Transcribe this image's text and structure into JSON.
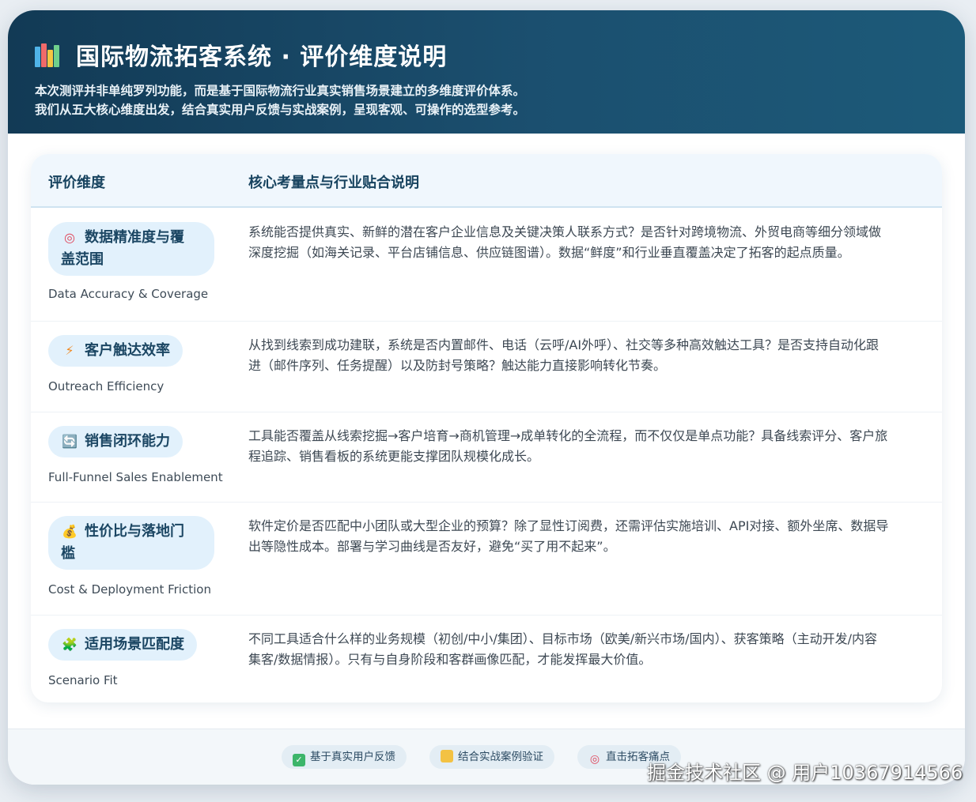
{
  "header": {
    "icon": "bar-chart-icon",
    "title": "国际物流拓客系统 · 评价维度说明",
    "subtitle_line1": "本次测评并非单纯罗列功能，而是基于国际物流行业真实销售场景建立的多维度评价体系。",
    "subtitle_line2": "我们从五大核心维度出发，结合真实用户反馈与实战案例，呈现客观、可操作的选型参考。"
  },
  "table": {
    "col1": "评价维度",
    "col2": "核心考量点与行业贴合说明",
    "rows": [
      {
        "icon": "target-icon",
        "name": "数据精准度与覆盖范围",
        "name_line1": "数据精准度与覆",
        "name_line2": "盖范围",
        "en": "Data Accuracy & Coverage",
        "desc_line1": "系统能否提供真实、新鲜的潜在客户企业信息及关键决策人联系方式？是否针对跨境物流、外贸电商等细分领域做",
        "desc_line2": "深度挖掘（如海关记录、平台店铺信息、供应链图谱）。数据“鲜度”和行业垂直覆盖决定了拓客的起点质量。"
      },
      {
        "icon": "lightning-icon",
        "name": "客户触达效率",
        "en": "Outreach Efficiency",
        "desc_line1": "从找到线索到成功建联，系统是否内置邮件、电话（云呼/AI外呼）、社交等多种高效触达工具？是否支持自动化跟",
        "desc_line2": "进（邮件序列、任务提醒）以及防封号策略？触达能力直接影响转化节奏。"
      },
      {
        "icon": "cycle-icon",
        "name": "销售闭环能力",
        "en": "Full-Funnel Sales Enablement",
        "desc_line1": "工具能否覆盖从线索挖掘→客户培育→商机管理→成单转化的全流程，而不仅仅是单点功能？具备线索评分、客户旅",
        "desc_line2": "程追踪、销售看板的系统更能支撑团队规模化成长。"
      },
      {
        "icon": "money-bag-icon",
        "name": "性价比与落地门槛",
        "name_line1": "性价比与落地门",
        "name_line2": "槛",
        "en": "Cost & Deployment Friction",
        "desc_line1": "软件定价是否匹配中小团队或大型企业的预算？除了显性订阅费，还需评估实施培训、API对接、额外坐席、数据导",
        "desc_line2": "出等隐性成本。部署与学习曲线是否友好，避免“买了用不起来”。"
      },
      {
        "icon": "puzzle-icon",
        "name": "适用场景匹配度",
        "en": "Scenario Fit",
        "desc_line1": "不同工具适合什么样的业务规模（初创/中小/集团）、目标市场（欧美/新兴市场/国内）、获客策略（主动开发/内容",
        "desc_line2": "集客/数据情报）。只有与自身阶段和客群画像匹配，才能发挥最大价值。"
      }
    ]
  },
  "footer": {
    "chips": [
      {
        "icon": "check-icon",
        "label": "基于真实用户反馈"
      },
      {
        "icon": "folder-icon",
        "label": "结合实战案例验证"
      },
      {
        "icon": "target-icon",
        "label": "直击拓客痛点"
      }
    ]
  },
  "watermark": "掘金技术社区 @ 用户10367914566",
  "colors": {
    "header_bg": "#1b4f6f",
    "pill_bg": "#e2f1fc",
    "accent_text": "#17435f"
  }
}
